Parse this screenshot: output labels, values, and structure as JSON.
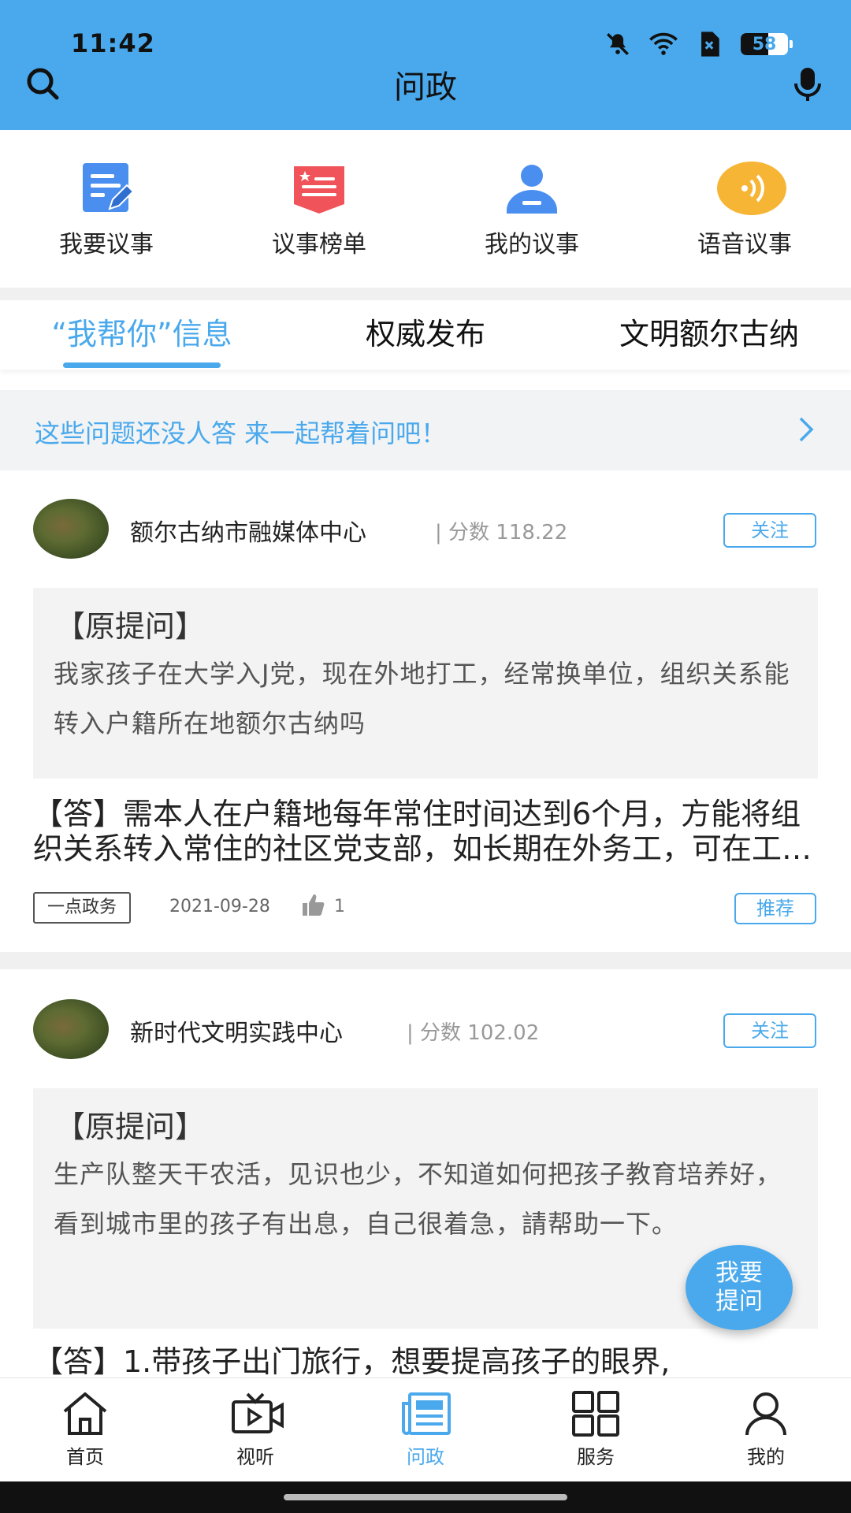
{
  "status_bar": {
    "time": "11:42",
    "battery": "58"
  },
  "header": {
    "title": "问政"
  },
  "actions": [
    {
      "label": "我要议事",
      "icon": "edit-document-icon"
    },
    {
      "label": "议事榜单",
      "icon": "ranking-list-icon"
    },
    {
      "label": "我的议事",
      "icon": "user-icon"
    },
    {
      "label": "语音议事",
      "icon": "voice-icon"
    }
  ],
  "tabs": [
    "“我帮你”信息",
    "权威发布",
    "文明额尔古纳"
  ],
  "prompt": {
    "text": "这些问题还没人答 来一起帮着问吧！"
  },
  "cards": [
    {
      "org": "额尔古纳市融媒体中心",
      "score": "| 分数 118.22",
      "follow": "关注",
      "q_title": "【原提问】",
      "question": "我家孩子在大学入J党，现在外地打工，经常换单位，组织关系能转入户籍所在地额尔古纳吗",
      "answer": "【答】需本人在户籍地每年常住时间达到6个月，方能将组织关系转入常住的社区党支部，如长期在外务工，可在工作地党组织参加组织生活。",
      "tag": "一点政务",
      "date": "2021-09-28",
      "likes": "1",
      "recommend": "推荐"
    },
    {
      "org": "新时代文明实践中心",
      "score": "| 分数 102.02",
      "follow": "关注",
      "q_title": "【原提问】",
      "question": "生产队整天干农活，见识也少，不知道如何把孩子教育培养好，看到城市里的孩子有出息，自己很着急，請帮助一下。",
      "answer": "【答】1.带孩子出门旅行，想要提高孩子的眼界,"
    }
  ],
  "fab": {
    "line1": "我要",
    "line2": "提问"
  },
  "nav": [
    {
      "label": "首页"
    },
    {
      "label": "视听"
    },
    {
      "label": "问政",
      "active": true
    },
    {
      "label": "服务"
    },
    {
      "label": "我的"
    }
  ]
}
